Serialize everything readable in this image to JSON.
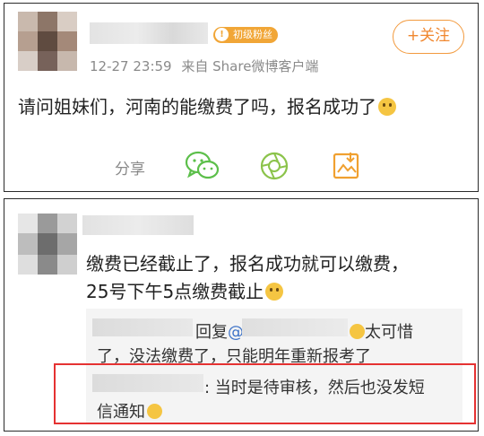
{
  "post": {
    "badge": "初级粉丝",
    "follow_label": "+关注",
    "timestamp": "12-27 23:59",
    "source": "来自 Share微博客户端",
    "text": "请问姐妹们，河南的能缴费了吗，报名成功了",
    "share_label": "分享",
    "icons": [
      "wechat-icon",
      "moments-icon",
      "save-image-icon"
    ]
  },
  "reply": {
    "line1": "缴费已经截止了，报名成功就可以缴费，",
    "line2": "25号下午5点缴费截止",
    "quote": {
      "r1_prefix": "回复",
      "r1_at": "@",
      "r1_suffix": "太可惜",
      "r1_line2": "了，没法缴费了，只能明年重新报考了",
      "r2_prefix": ": 当时是待审核，然后也没发短",
      "r2_line2": "信通知"
    }
  },
  "colors": {
    "accent": "#f0872f",
    "badge": "#f1a637",
    "link": "#3d72c7",
    "highlight": "#e53232"
  }
}
